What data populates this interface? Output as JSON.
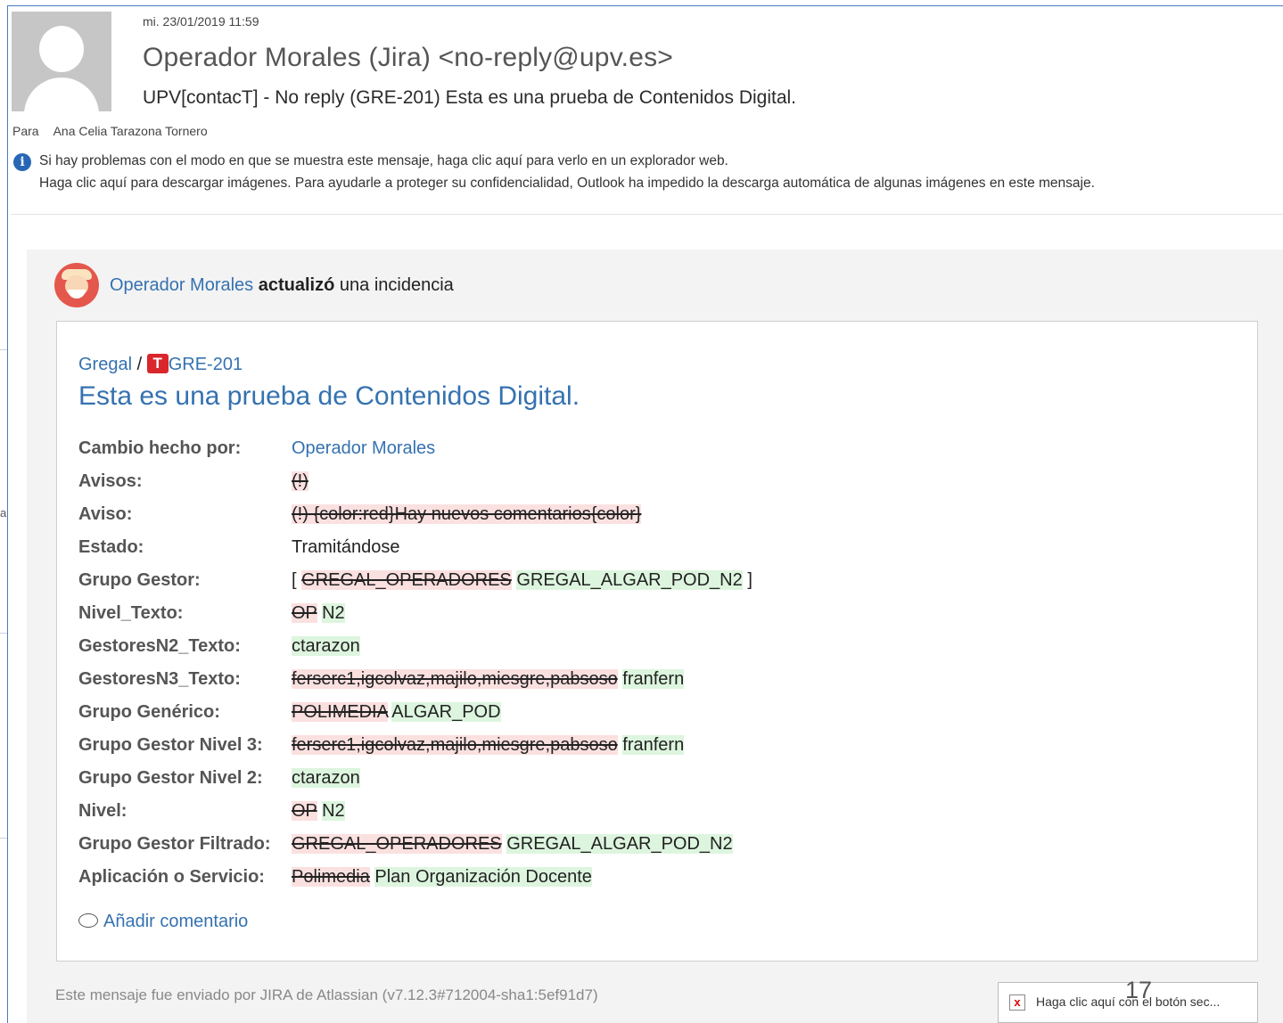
{
  "header": {
    "date": "mi. 23/01/2019 11:59",
    "sender": "Operador Morales (Jira) <no-reply@upv.es>",
    "subject": "UPV[contacT] - No reply (GRE-201) Esta es una prueba de Contenidos Digital.",
    "to_label": "Para",
    "to_value": "Ana Celia Tarazona Tornero",
    "info_line1": "Si hay problemas con el modo en que se muestra este mensaje, haga clic aquí para verlo en un explorador web.",
    "info_line2": "Haga clic aquí para descargar imágenes. Para ayudarle a proteger su confidencialidad, Outlook ha impedido la descarga automática de algunas imágenes en este mensaje."
  },
  "left_strip_char": "a",
  "activity": {
    "actor": "Operador Morales",
    "verb": "actualizó",
    "object": "una incidencia"
  },
  "issue": {
    "project": "Gregal",
    "separator": "/",
    "type_icon_letter": "T",
    "key": "GRE-201",
    "title": "Esta es una prueba de Contenidos Digital."
  },
  "fields": [
    {
      "label": "Cambio hecho por:",
      "changed_by": "Operador Morales"
    },
    {
      "label": "Avisos:",
      "old": "(!)"
    },
    {
      "label": "Aviso:",
      "old": "(!) {color:red}Hay nuevos comentarios{color}"
    },
    {
      "label": "Estado:",
      "value": "Tramitándose"
    },
    {
      "label": "Grupo Gestor:",
      "open": "[",
      "old": "GREGAL_OPERADORES",
      "new": "GREGAL_ALGAR_POD_N2",
      "close": "]"
    },
    {
      "label": "Nivel_Texto:",
      "old": "OP",
      "new": "N2"
    },
    {
      "label": "GestoresN2_Texto:",
      "new": "ctarazon"
    },
    {
      "label": "GestoresN3_Texto:",
      "old": "ferserc1,igcolvaz,majilo,miesgre,pabsoso",
      "new": "franfern"
    },
    {
      "label": "Grupo Genérico:",
      "old": "POLIMEDIA",
      "new": "ALGAR_POD"
    },
    {
      "label": "Grupo Gestor Nivel 3:",
      "old": "ferserc1,igcolvaz,majilo,miesgre,pabsoso",
      "new": "franfern"
    },
    {
      "label": "Grupo Gestor Nivel 2:",
      "new": "ctarazon"
    },
    {
      "label": "Nivel:",
      "old": "OP",
      "new": "N2"
    },
    {
      "label": "Grupo Gestor Filtrado:",
      "old": "GREGAL_OPERADORES",
      "new": "GREGAL_ALGAR_POD_N2"
    },
    {
      "label": "Aplicación o Servicio:",
      "old": "Polimedia",
      "new": "Plan Organización Docente"
    }
  ],
  "add_comment": "Añadir comentario",
  "footer": "Este mensaje fue enviado por JIRA de Atlassian (v7.12.3#712004-sha1:5ef91d7)",
  "blocked_image_alt": "Haga clic aquí con el botón sec...",
  "page_number": "17",
  "colors": {
    "link": "#3572b0",
    "deleted_bg": "#fbe0e0",
    "inserted_bg": "#ddf5de",
    "panel_bg": "#f3f3f3",
    "info_icon": "#2767b5",
    "issue_type_icon": "#d9262c"
  }
}
